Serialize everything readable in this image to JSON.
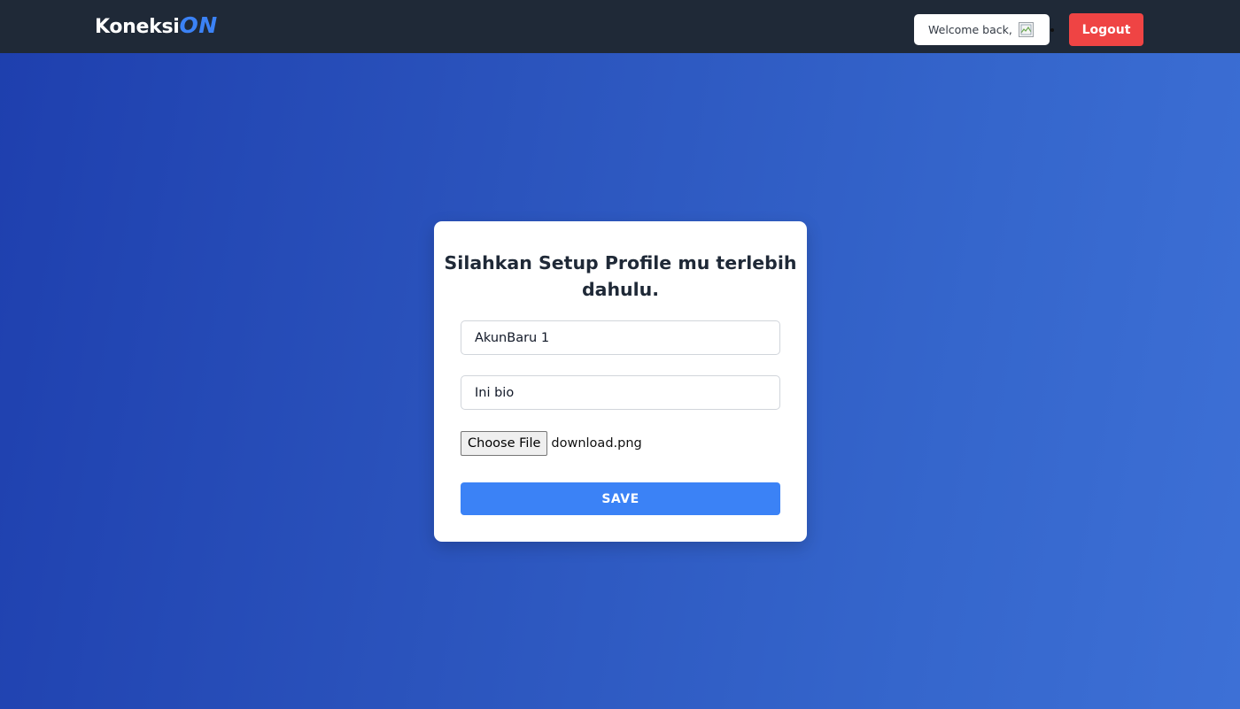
{
  "navbar": {
    "brand_main": "Koneksi",
    "brand_accent": "ON",
    "welcome_text": "Welcome back,",
    "avatar_icon": "broken-image-icon",
    "logout_label": "Logout"
  },
  "profile_form": {
    "title": "Silahkan Setup Profile mu terlebih dahulu.",
    "name_value": "AkunBaru 1",
    "bio_value": "Ini bio",
    "file_button_label": "Choose File",
    "file_name": "download.png",
    "save_label": "SAVE"
  },
  "colors": {
    "navbar_bg": "#1f2937",
    "brand_accent": "#3b82f6",
    "logout_bg": "#ef4444",
    "save_bg": "#3b82f6",
    "background_gradient_start": "#1e3fae",
    "background_gradient_end": "#3d70d6"
  }
}
